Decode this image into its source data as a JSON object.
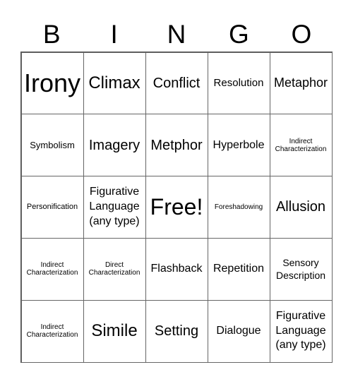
{
  "header": {
    "letters": [
      "B",
      "I",
      "N",
      "G",
      "O"
    ]
  },
  "card": {
    "rows": [
      [
        "Irony",
        "Climax",
        "Conflict",
        "Resolution",
        "Metaphor"
      ],
      [
        "Symbolism",
        "Imagery",
        "Metphor",
        "Hyperbole",
        "Indirect Characterization"
      ],
      [
        "Personification",
        "Figurative Language (any type)",
        "Free!",
        "Foreshadowing",
        "Allusion"
      ],
      [
        "Indirect Characterization",
        "Direct Characterization",
        "Flashback",
        "Repetition",
        "Sensory Description"
      ],
      [
        "Indirect Characterization",
        "Simile",
        "Setting",
        "Dialogue",
        "Figurative Language (any type)"
      ]
    ]
  }
}
